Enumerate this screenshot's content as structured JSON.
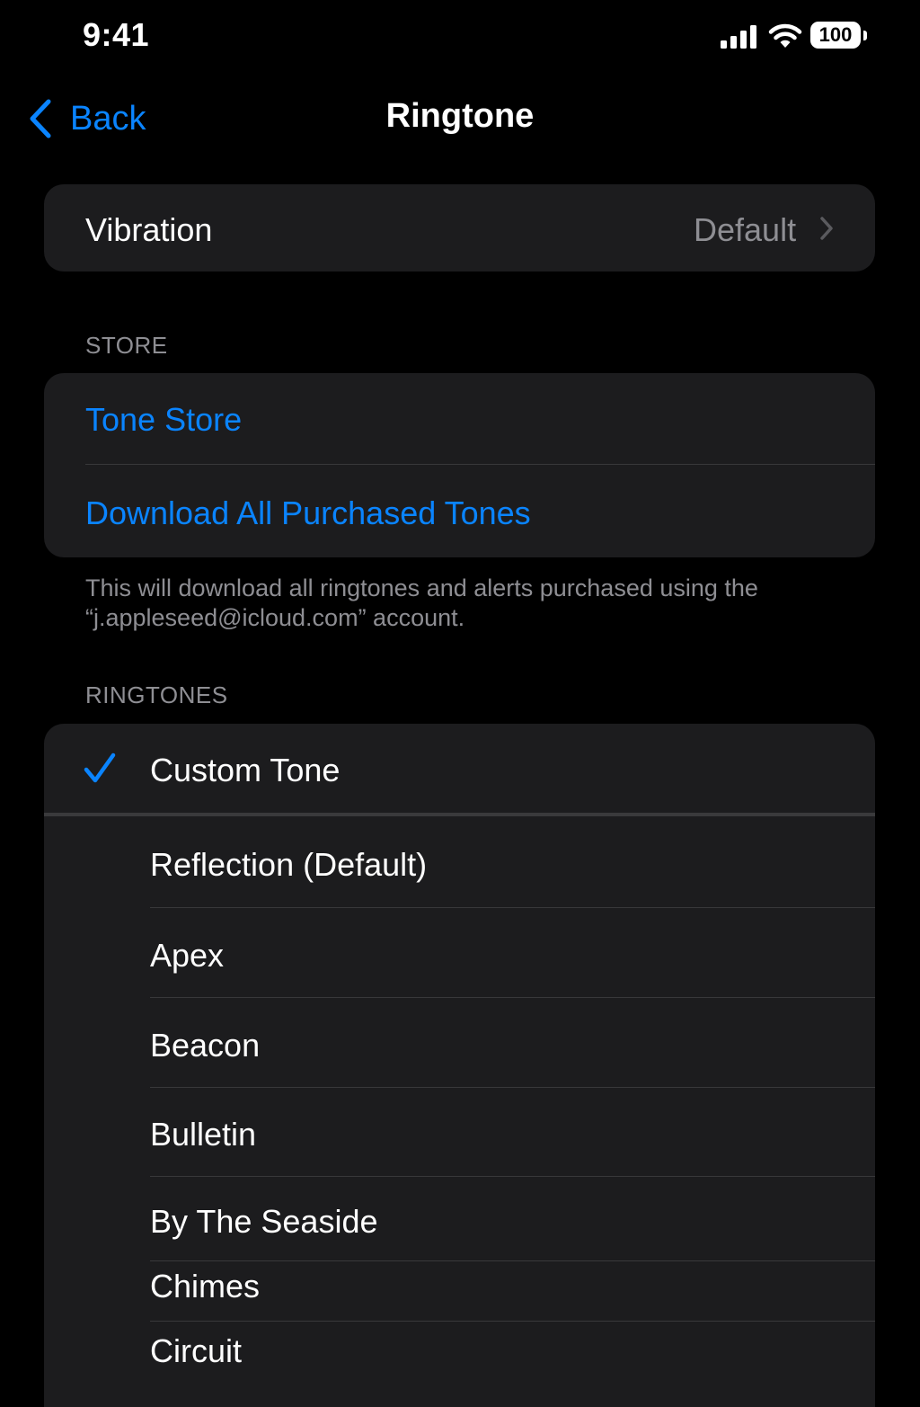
{
  "status_bar": {
    "time": "9:41",
    "battery": "100",
    "icons": [
      "signal-icon",
      "wifi-icon",
      "battery-icon"
    ]
  },
  "nav": {
    "back_label": "Back",
    "title": "Ringtone"
  },
  "vibration": {
    "label": "Vibration",
    "value": "Default"
  },
  "store": {
    "header": "STORE",
    "items": [
      {
        "label": "Tone Store"
      },
      {
        "label": "Download All Purchased Tones"
      }
    ],
    "footer": "This will download all ringtones and alerts purchased using the “j.appleseed@icloud.com” account."
  },
  "ringtones": {
    "header": "RINGTONES",
    "items": [
      {
        "label": "Custom Tone",
        "selected": true
      },
      {
        "label": "Reflection (Default)",
        "selected": false
      },
      {
        "label": "Apex",
        "selected": false
      },
      {
        "label": "Beacon",
        "selected": false
      },
      {
        "label": "Bulletin",
        "selected": false
      },
      {
        "label": "By The Seaside",
        "selected": false
      },
      {
        "label": "Chimes",
        "selected": false
      },
      {
        "label": "Circuit",
        "selected": false
      }
    ]
  },
  "colors": {
    "accent": "#0a84ff",
    "background": "#000000",
    "group_background": "#1c1c1e",
    "secondary_text": "#8e8e93",
    "separator": "#38383a"
  }
}
